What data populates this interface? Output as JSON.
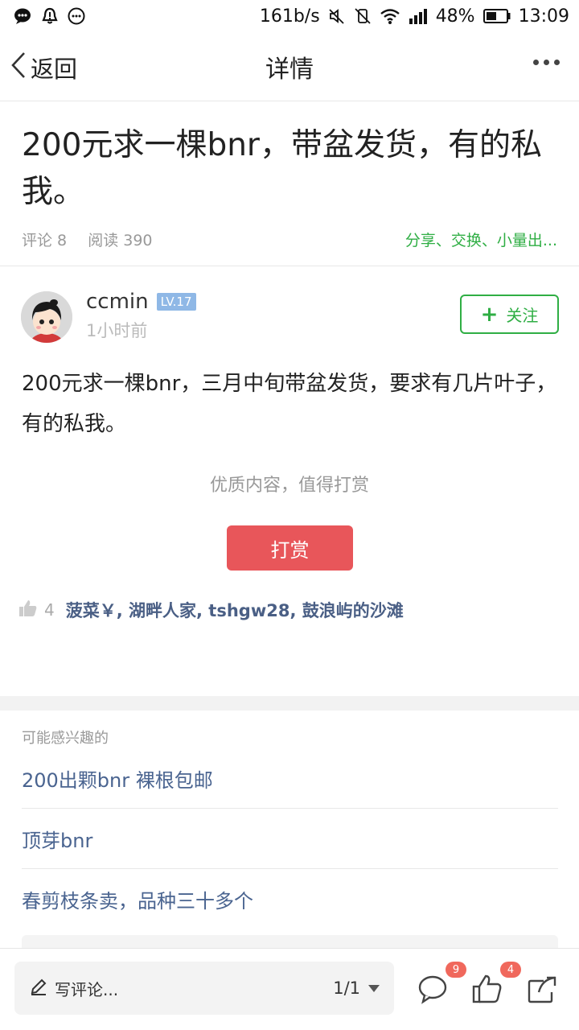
{
  "status_bar": {
    "network_speed": "161b/s",
    "battery": "48%",
    "time": "13:09"
  },
  "nav": {
    "back_label": "返回",
    "title": "详情"
  },
  "post": {
    "title": "200元求一棵bnr，带盆发货，有的私我。",
    "comments": "评论 8",
    "reads": "阅读 390",
    "tags": "分享、交换、小量出...",
    "author": "ccmin",
    "level": "LV.17",
    "time": "1小时前",
    "follow_label": "关注",
    "body": "200元求一棵bnr，三月中旬带盆发货，要求有几片叶子，有的私我。",
    "reward_hint": "优质内容，值得打赏",
    "reward_button": "打赏",
    "likes_count": "4",
    "likes_users": "菠菜￥, 湖畔人家, tshgw28, 鼓浪屿的沙滩"
  },
  "related": {
    "heading": "可能感兴趣的",
    "items": [
      "200出颗bnr 裸根包邮",
      "顶芽bnr",
      "春剪枝条卖，品种三十多个"
    ]
  },
  "bottom_bar": {
    "comment_placeholder": "写评论...",
    "page_indicator": "1/1",
    "comment_badge": "9",
    "like_badge": "4"
  },
  "colors": {
    "accent_green": "#2fae44",
    "reward_red": "#e8565a",
    "link_blue": "#4a6490",
    "badge_red": "#f0685c"
  }
}
